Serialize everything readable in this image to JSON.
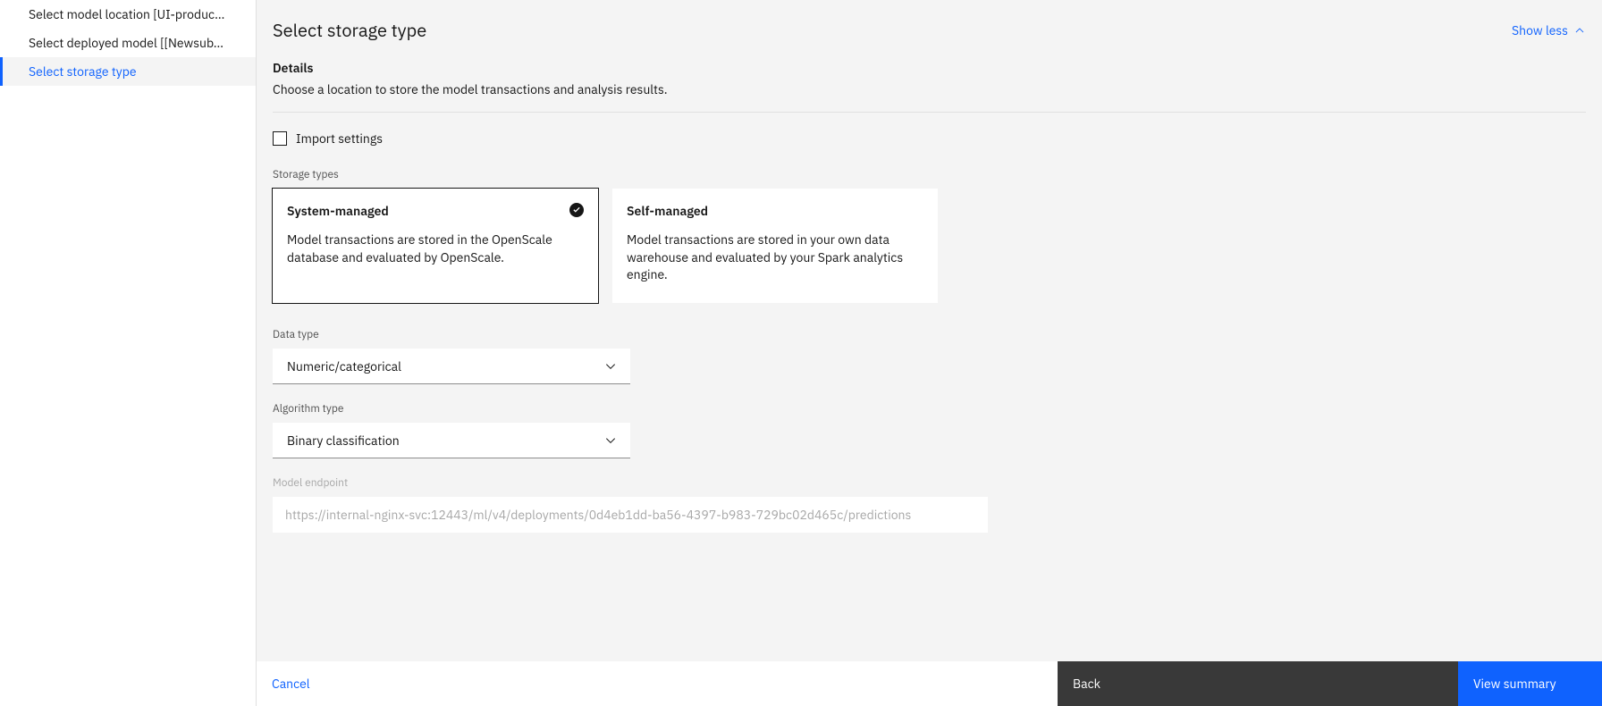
{
  "sidebar": {
    "items": [
      {
        "label": "Select model location [UI-produc…",
        "active": false
      },
      {
        "label": "Select deployed model [[Newsub…",
        "active": false
      },
      {
        "label": "Select storage type",
        "active": true
      }
    ]
  },
  "header": {
    "title": "Select storage type",
    "show_less": "Show less"
  },
  "details": {
    "heading": "Details",
    "description": "Choose a location to store the model transactions and analysis results."
  },
  "checkbox": {
    "label": "Import settings",
    "checked": false
  },
  "storage_types": {
    "label": "Storage types",
    "tiles": [
      {
        "title": "System-managed",
        "desc": "Model transactions are stored in the OpenScale database and evaluated by OpenScale.",
        "selected": true
      },
      {
        "title": "Self-managed",
        "desc": "Model transactions are stored in your own data warehouse and evaluated by your Spark analytics engine.",
        "selected": false
      }
    ]
  },
  "data_type": {
    "label": "Data type",
    "value": "Numeric/categorical"
  },
  "algorithm_type": {
    "label": "Algorithm type",
    "value": "Binary classification"
  },
  "model_endpoint": {
    "label": "Model endpoint",
    "value": "https://internal-nginx-svc:12443/ml/v4/deployments/0d4eb1dd-ba56-4397-b983-729bc02d465c/predictions"
  },
  "footer": {
    "cancel": "Cancel",
    "back": "Back",
    "next": "View summary"
  }
}
